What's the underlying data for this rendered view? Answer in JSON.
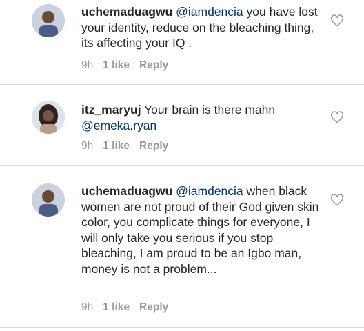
{
  "comments": [
    {
      "username": "uchemaduagwu",
      "mention": "@iamdencia",
      "text": " you have lost your identity, reduce on the bleaching thing, its affecting your IQ .",
      "time": "9h",
      "likes": "1 like",
      "reply": "Reply",
      "avatar_icon": "user-avatar-man"
    },
    {
      "username": "itz_maryuj",
      "text_before": " Your brain is there mahn ",
      "mention": "@emeka.ryan",
      "time": "9h",
      "likes": "1 like",
      "reply": "Reply",
      "avatar_icon": "user-avatar-woman"
    },
    {
      "username": "uchemaduagwu",
      "mention": "@iamdencia",
      "text": " when black women are not proud of their God given skin color, you complicate things for everyone, I will only take you serious if you stop bleaching, I am proud to be an Igbo man, money is not a problem...",
      "time": "9h",
      "likes": "1 like",
      "reply": "Reply",
      "avatar_icon": "user-avatar-man"
    }
  ],
  "icons": {
    "like": "heart-outline-icon"
  },
  "colors": {
    "text": "#262626",
    "mention": "#003569",
    "meta": "#999999",
    "divider": "#dbdbdb"
  }
}
